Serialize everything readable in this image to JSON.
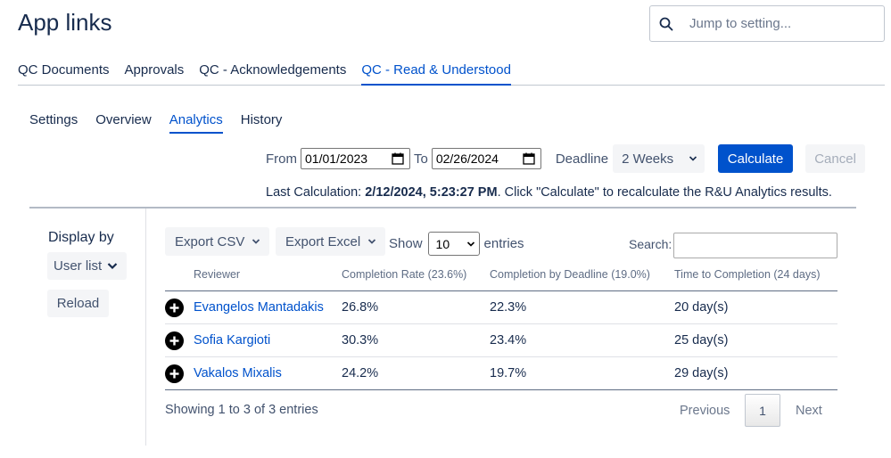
{
  "page": {
    "title": "App links"
  },
  "search": {
    "placeholder": "Jump to setting..."
  },
  "main_tabs": [
    {
      "label": "QC Documents"
    },
    {
      "label": "Approvals"
    },
    {
      "label": "QC - Acknowledgements"
    },
    {
      "label": "QC - Read & Understood",
      "active": true
    }
  ],
  "sub_tabs": [
    {
      "label": "Settings"
    },
    {
      "label": "Overview"
    },
    {
      "label": "Analytics",
      "active": true
    },
    {
      "label": "History"
    }
  ],
  "calc": {
    "from_label": "From",
    "from_value": "01/01/2023",
    "to_label": "To",
    "to_value": "02/26/2024",
    "deadline_label": "Deadline",
    "deadline_value": "2 Weeks",
    "calculate_label": "Calculate",
    "cancel_label": "Cancel"
  },
  "last_calc": {
    "prefix": "Last Calculation: ",
    "timestamp": "2/12/2024, 5:23:27 PM",
    "suffix": ". Click \"Calculate\" to recalculate the R&U Analytics results."
  },
  "sidebar": {
    "display_by_label": "Display by",
    "display_by_value": "User list",
    "reload_label": "Reload"
  },
  "toolbar": {
    "export_csv_label": "Export CSV",
    "export_excel_label": "Export Excel",
    "show_label": "Show",
    "entries_value": "10",
    "entries_label": "entries",
    "search_label": "Search:"
  },
  "table": {
    "headers": {
      "reviewer": "Reviewer",
      "completion_rate": "Completion Rate (23.6%)",
      "completion_deadline": "Completion by Deadline (19.0%)",
      "time_to_completion": "Time to Completion (24 days)"
    },
    "rows": [
      {
        "reviewer": "Evangelos Mantadakis",
        "completion_rate": "26.8%",
        "completion_deadline": "22.3%",
        "time": "20 day(s)"
      },
      {
        "reviewer": "Sofia Kargioti",
        "completion_rate": "30.3%",
        "completion_deadline": "23.4%",
        "time": "25 day(s)"
      },
      {
        "reviewer": "Vakalos Mixalis",
        "completion_rate": "24.2%",
        "completion_deadline": "19.7%",
        "time": "29 day(s)"
      }
    ]
  },
  "footer": {
    "showing": "Showing 1 to 3 of 3 entries",
    "previous_label": "Previous",
    "page": "1",
    "next_label": "Next"
  },
  "colors": {
    "accent": "#0052cc",
    "text": "#172b4d",
    "button_bg": "#f4f5f7"
  }
}
